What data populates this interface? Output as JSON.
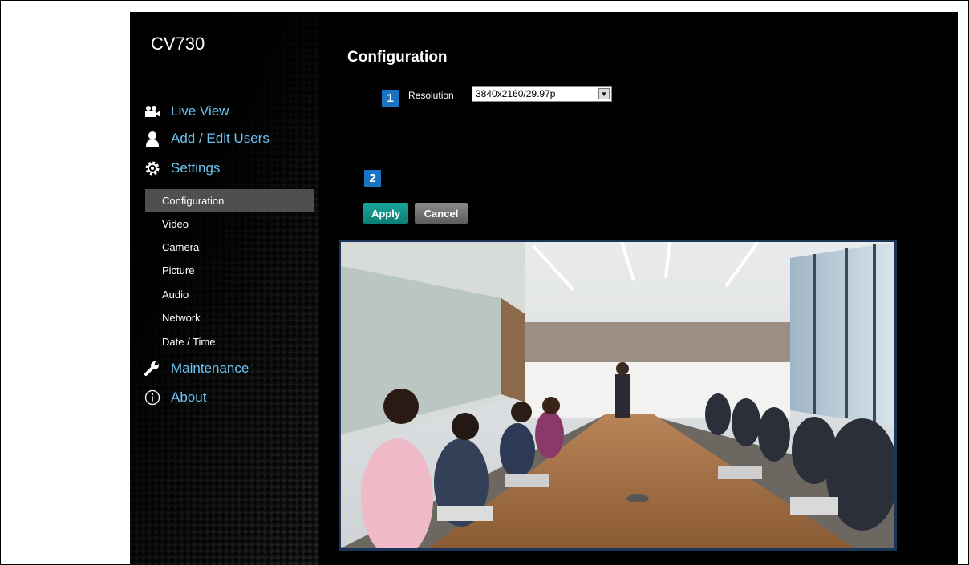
{
  "app": {
    "title": "CV730"
  },
  "nav": {
    "main": [
      {
        "label": "Live View",
        "icon": "video-camera-icon"
      },
      {
        "label": "Add / Edit Users",
        "icon": "user-icon"
      },
      {
        "label": "Settings",
        "icon": "gear-icon"
      },
      {
        "label": "Maintenance",
        "icon": "wrench-icon"
      },
      {
        "label": "About",
        "icon": "info-icon"
      }
    ],
    "settings_sub": [
      {
        "label": "Configuration",
        "active": true
      },
      {
        "label": "Video"
      },
      {
        "label": "Camera"
      },
      {
        "label": "Picture"
      },
      {
        "label": "Audio"
      },
      {
        "label": "Network"
      },
      {
        "label": "Date / Time"
      }
    ]
  },
  "page": {
    "title": "Configuration",
    "badge_1": "1",
    "badge_2": "2",
    "resolution": {
      "label": "Resolution",
      "value": "3840x2160/29.97p"
    },
    "buttons": {
      "apply": "Apply",
      "cancel": "Cancel"
    }
  },
  "colors": {
    "nav_link": "#6ec3f2",
    "active_bg": "#4f4f4f",
    "badge": "#1a74c6",
    "apply": "#139489",
    "cancel": "#6e6e6e",
    "preview_border": "#1c3558"
  }
}
